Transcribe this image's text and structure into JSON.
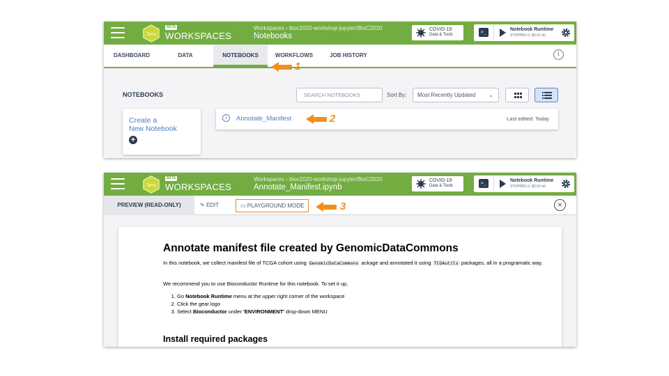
{
  "header": {
    "logo_text": "Terra",
    "beta": "BETA",
    "brand": "WORKSPACES",
    "covid_line1": "COVID-19",
    "covid_line2": "Data & Tools",
    "runtime_title": "Notebook Runtime",
    "runtime_status": "STOPPED (< $0.01 hr)",
    "terminal_glyph": ">_"
  },
  "panel1": {
    "breadcrumb": "Workspaces › bioc2020-workshop-jupyter/BioC2020",
    "title": "Notebooks",
    "tabs": [
      {
        "label": "DASHBOARD"
      },
      {
        "label": "DATA"
      },
      {
        "label": "NOTEBOOKS"
      },
      {
        "label": "WORKFLOWS"
      },
      {
        "label": "JOB HISTORY"
      }
    ],
    "info_glyph": "i",
    "section_title": "NOTEBOOKS",
    "search_placeholder": "SEARCH NOTEBOOKS",
    "sort_label": "Sort By:",
    "sort_value": "Most Recently Updated",
    "create_line1": "Create a",
    "create_line2": "New Notebook",
    "notebook_name": "Annotate_Manifest",
    "last_edited": "Last edited: Today"
  },
  "panel2": {
    "breadcrumb": "Workspaces › bioc2020-workshop-jupyter/BioC2020",
    "title": "Annotate_Manifest.ipynb",
    "preview_tab": "PREVIEW (READ-ONLY)",
    "edit_label": "EDIT",
    "playground_label": "PLAYGROUND MODE",
    "doc": {
      "heading": "Annotate manifest file created by GenomicDataCommons",
      "p1_a": "In this notebook, we collect manifest file of TCGA cohort using ",
      "p1_code1": "GenomicDataCommons",
      "p1_b": " ackage and annotated it using ",
      "p1_code2": "TCGAutils",
      "p1_c": " packages, all in a programatic way.",
      "p2": "We recommend you to use Bioconductor Runtime for this notebook. To set it up,",
      "step1_a": "Go ",
      "step1_b": "Notebook Runtime",
      "step1_c": " menu at the upper right corner of the workspace",
      "step2": "Click the gear logo",
      "step3_a": "Select ",
      "step3_b": "Bioconductor",
      "step3_c": " under ",
      "step3_d": "'ENVIRONMENT'",
      "step3_e": " drop-down MENU",
      "subheading": "Install required packages"
    }
  },
  "annotations": {
    "n1": "1",
    "n2": "2",
    "n3": "3",
    "color": "#f28f1c"
  },
  "colors": {
    "brand_green": "#73ad42",
    "navy": "#2b3a53",
    "link_blue": "#4a7fc1"
  }
}
